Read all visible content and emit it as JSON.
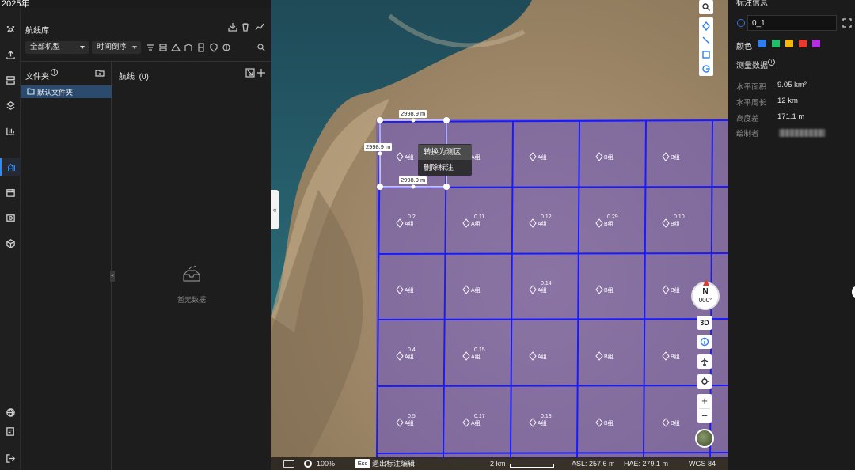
{
  "app": {
    "title": "2025年"
  },
  "library": {
    "title": "航线库",
    "filter_model": "全部机型",
    "filter_sort": "时间倒序",
    "folders_title": "文件夹",
    "default_folder": "默认文件夹",
    "routes_title": "航线",
    "routes_count": "(0)",
    "empty_text": "暂无数据"
  },
  "map": {
    "context_menu": [
      "转换为测区",
      "删除标注"
    ],
    "dimension_labels": {
      "top": "2998.9 m",
      "left": "2998.9 m",
      "bottom": "2998.9 m"
    },
    "grid": {
      "rows": [
        {
          "cells": [
            {
              "label": "A组",
              "num": ""
            },
            {
              "label": "A组",
              "num": ""
            },
            {
              "label": "A组",
              "num": ""
            },
            {
              "label": "B组",
              "num": ""
            },
            {
              "label": "B组",
              "num": ""
            }
          ]
        },
        {
          "cells": [
            {
              "label": "A组",
              "num": "0.2"
            },
            {
              "label": "A组",
              "num": "0.11"
            },
            {
              "label": "A组",
              "num": "0.12"
            },
            {
              "label": "B组",
              "num": "0.29"
            },
            {
              "label": "B组",
              "num": "0.10"
            }
          ]
        },
        {
          "cells": [
            {
              "label": "A组",
              "num": ""
            },
            {
              "label": "A组",
              "num": ""
            },
            {
              "label": "A组",
              "num": "0.14"
            },
            {
              "label": "B组",
              "num": ""
            },
            {
              "label": "B组",
              "num": ""
            }
          ]
        },
        {
          "cells": [
            {
              "label": "A组",
              "num": "0.4"
            },
            {
              "label": "A组",
              "num": "0.15"
            },
            {
              "label": "A组",
              "num": ""
            },
            {
              "label": "B组",
              "num": ""
            },
            {
              "label": "B组",
              "num": ""
            }
          ]
        },
        {
          "cells": [
            {
              "label": "A组",
              "num": "0.5"
            },
            {
              "label": "A组",
              "num": "0.17"
            },
            {
              "label": "A组",
              "num": "0.18"
            },
            {
              "label": "B组",
              "num": ""
            },
            {
              "label": "B组",
              "num": ""
            }
          ]
        }
      ]
    },
    "compass": {
      "letter": "N",
      "heading": "000°"
    },
    "view_mode": "3D",
    "zoom_in": "+",
    "zoom_out": "−"
  },
  "status": {
    "opacity": "100%",
    "esc_key": "Esc",
    "esc_text": "退出标注编辑",
    "scale": "2 km",
    "asl": "ASL: 257.6 m",
    "hae": "HAE: 279.1 m",
    "crs": "WGS 84"
  },
  "info": {
    "title": "标注信息",
    "name_value": "0_1",
    "color_label": "颜色",
    "colors": [
      "#2f7ef0",
      "#1fbf6a",
      "#f2b80f",
      "#e63b2e",
      "#b52ee0"
    ],
    "measure_title": "测量数据",
    "area_label": "水平面积",
    "area_value": "9.05 km²",
    "perimeter_label": "水平周长",
    "perimeter_value": "12 km",
    "height_label": "高度差",
    "height_value": "171.1 m",
    "author_label": "绘制者"
  }
}
